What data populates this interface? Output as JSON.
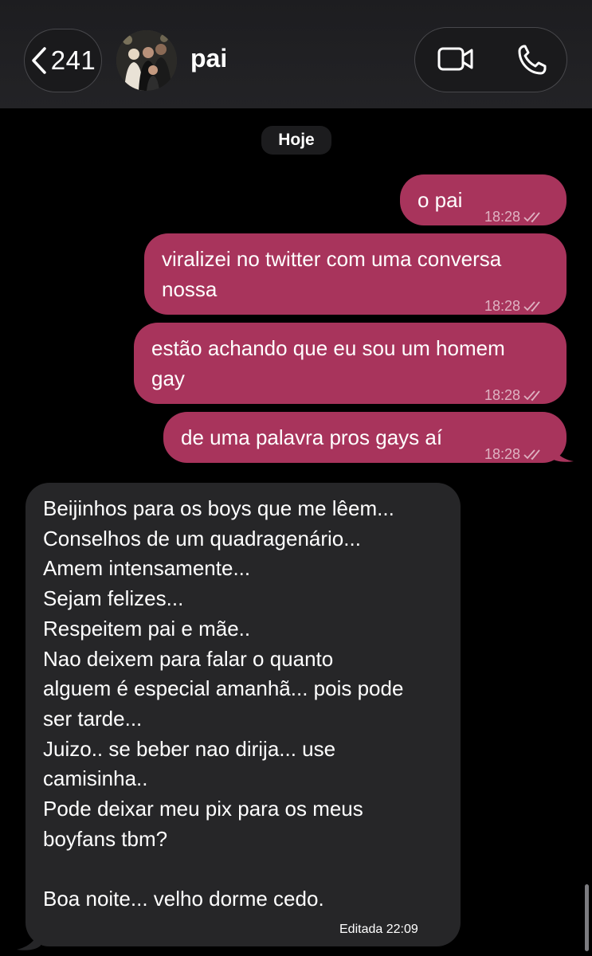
{
  "header": {
    "back_count": "241",
    "contact_name": "pai"
  },
  "date_chip": "Hoje",
  "outgoing": [
    {
      "text": "o pai",
      "time": "18:28"
    },
    {
      "text": "viralizei no twitter com uma conversa\nnossa",
      "time": "18:28"
    },
    {
      "text": "estão achando que eu sou um homem\ngay",
      "time": "18:28"
    },
    {
      "text": "de uma palavra pros gays aí",
      "time": "18:28"
    }
  ],
  "incoming": {
    "text": "Beijinhos para os boys que me lêem...\nConselhos de um quadragenário...\nAmem intensamente...\nSejam felizes...\nRespeitem pai e mãe..\nNao deixem para falar o quanto\nalguem é especial amanhã... pois pode\nser tarde...\nJuizo.. se beber nao dirija... use\ncamisinha..\nPode deixar meu pix para os meus\nboyfans tbm?\n\nBoa noite... velho dorme cedo.",
    "edited_label": "Editada",
    "time": "22:09"
  },
  "colors": {
    "outgoing_bubble": "#a8345c",
    "incoming_bubble": "#262628",
    "background": "#000000"
  },
  "icons": [
    "chevron-left-icon",
    "video-camera-icon",
    "phone-icon",
    "double-check-icon"
  ]
}
